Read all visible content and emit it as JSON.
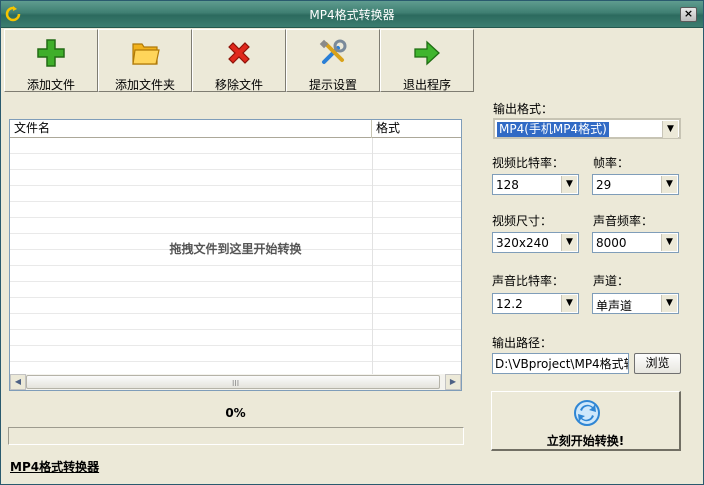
{
  "window": {
    "title": "MP4格式转换器",
    "close_label": "×"
  },
  "toolbar": [
    {
      "label": "添加文件",
      "icon": "plus-icon"
    },
    {
      "label": "添加文件夹",
      "icon": "folder-icon"
    },
    {
      "label": "移除文件",
      "icon": "x-icon"
    },
    {
      "label": "提示设置",
      "icon": "tools-icon"
    },
    {
      "label": "退出程序",
      "icon": "arrow-right-icon"
    }
  ],
  "file_list": {
    "columns": [
      "文件名",
      "格式"
    ],
    "hint": "拖拽文件到这里开始转换",
    "scroll_grip": "III"
  },
  "progress": {
    "percent_text": "0%",
    "value": 0
  },
  "app_link": "MP4格式转换器",
  "settings": {
    "output_format_label": "输出格式：",
    "output_format_value": "MP4(手机MP4格式)",
    "video_bitrate_label": "视频比特率：",
    "video_bitrate_value": "128",
    "framerate_label": "帧率：",
    "framerate_value": "29",
    "video_size_label": "视频尺寸：",
    "video_size_value": "320x240",
    "audio_rate_label": "声音频率：",
    "audio_rate_value": "8000",
    "audio_bitrate_label": "声音比特率：",
    "audio_bitrate_value": "12.2",
    "channel_label": "声道：",
    "channel_value": "单声道",
    "output_path_label": "输出路径：",
    "output_path_value": "D:\\VBproject\\MP4格式转",
    "browse_label": "浏览",
    "convert_label": "立刻开始转换!"
  },
  "colors": {
    "titlebar": "#3f7f72",
    "window_bg": "#ece9d8",
    "selection": "#316ac5"
  }
}
